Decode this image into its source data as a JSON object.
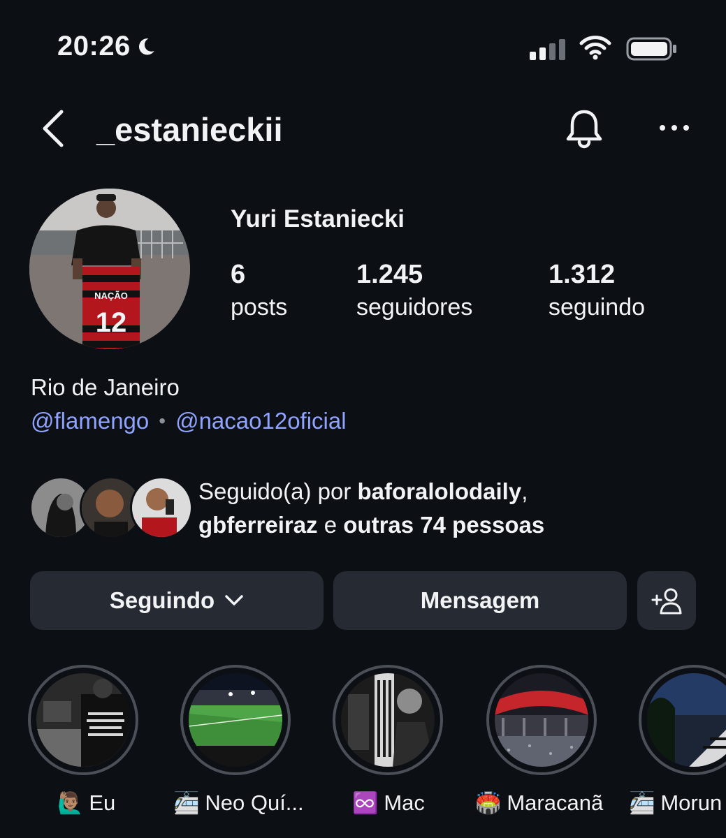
{
  "status_bar": {
    "time": "20:26"
  },
  "header": {
    "username": "_estanieckii"
  },
  "profile": {
    "name": "Yuri Estaniecki",
    "stats": [
      {
        "value": "6",
        "label": "posts"
      },
      {
        "value": "1.245",
        "label": "seguidores"
      },
      {
        "value": "1.312",
        "label": "seguindo"
      }
    ],
    "jersey_text": "NAÇÃO",
    "jersey_number": "12",
    "bio_location": "Rio de Janeiro",
    "link_1": "@flamengo",
    "link_separator": "•",
    "link_2": "@nacao12oficial"
  },
  "followed_by": {
    "prefix": "Seguido(a) por ",
    "user_1": "baforalolodaily",
    "comma": ",",
    "user_2": "gbferreiraz",
    "connector": " e ",
    "others": "outras 74 pessoas"
  },
  "actions": {
    "following_label": "Seguindo",
    "message_label": "Mensagem"
  },
  "highlights": [
    {
      "emoji": "🙋🏽‍♂️",
      "label": "Eu"
    },
    {
      "emoji": "🚈",
      "label": "Neo Quí..."
    },
    {
      "emoji": "♾️",
      "label": "Mac"
    },
    {
      "emoji": "🏟️",
      "label": "Maracanã"
    },
    {
      "emoji": "🚈",
      "label": "Morun"
    }
  ],
  "colors": {
    "background": "#0c0f14",
    "link": "#8fa3ff",
    "button": "#262a33"
  }
}
